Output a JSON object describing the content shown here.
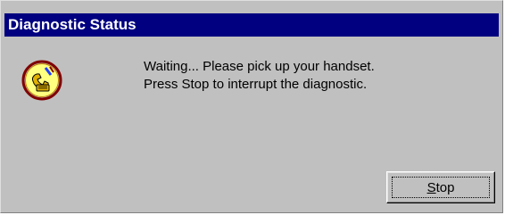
{
  "window": {
    "title": "Diagnostic Status",
    "title_bar_color": "#000080",
    "background_color": "#c0c0c0"
  },
  "icon": {
    "name": "telephone-handset-icon"
  },
  "message": {
    "line1": "Waiting... Please pick up your handset.",
    "line2": "Press Stop to interrupt the diagnostic."
  },
  "buttons": {
    "stop": {
      "hotkey": "S",
      "rest": "top"
    }
  }
}
